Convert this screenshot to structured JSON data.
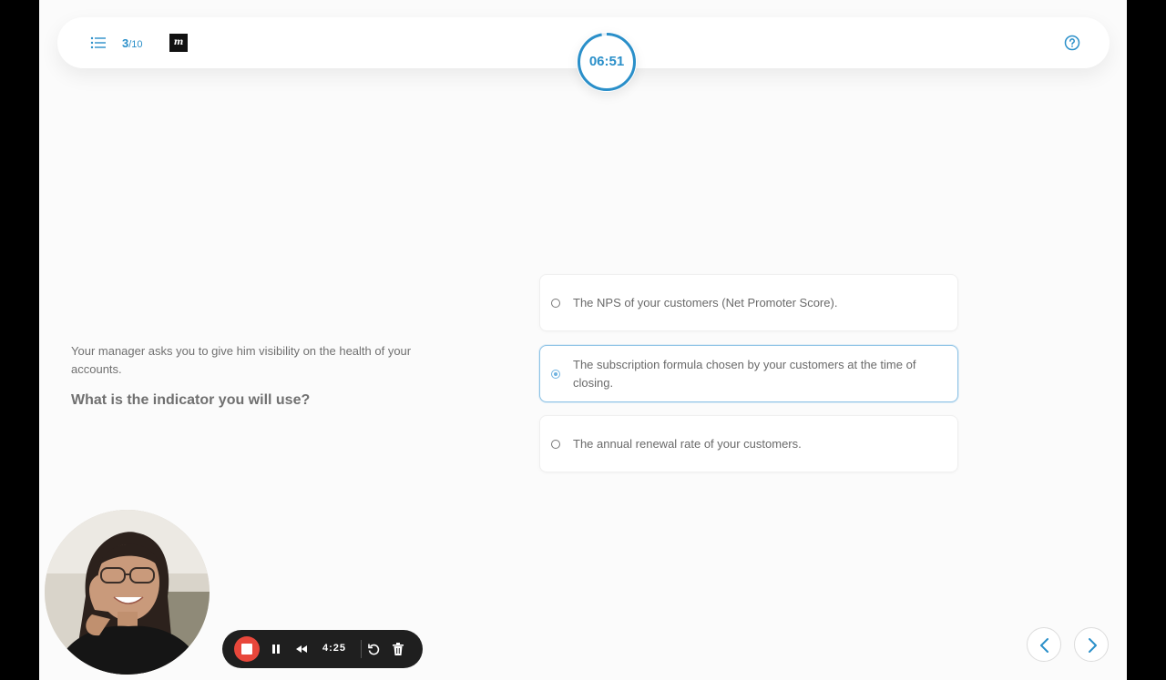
{
  "header": {
    "current_question": "3",
    "total_questions": "/10",
    "logo_text": "m",
    "timer": "06:51",
    "timer_progress": 0.97,
    "accent_color": "#2a8fc9"
  },
  "question": {
    "intro": "Your manager asks you to give him visibility on the health of your accounts.",
    "prompt": "What is the indicator you will use?"
  },
  "options": [
    {
      "label": "The NPS of your customers (Net Promoter Score).",
      "selected": false
    },
    {
      "label": "The subscription formula chosen by your customers at the time of closing.",
      "selected": true
    },
    {
      "label": "The annual renewal rate of your customers.",
      "selected": false
    }
  ],
  "recorder": {
    "elapsed": "4:25",
    "stop_color": "#e8473b"
  },
  "icons": [
    "list-icon",
    "help-icon",
    "stop-icon",
    "pause-icon",
    "rewind-icon",
    "restart-icon",
    "trash-icon",
    "chevron-left-icon",
    "chevron-right-icon"
  ]
}
